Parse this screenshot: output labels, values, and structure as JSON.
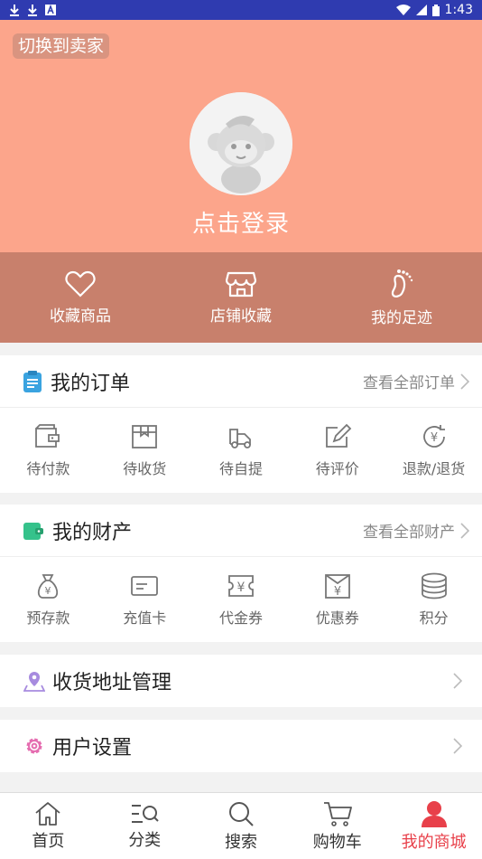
{
  "status_bar": {
    "time": "1:43",
    "icons_left": [
      "download-icon",
      "download-icon",
      "a-icon"
    ],
    "icons_right": [
      "wifi-icon",
      "signal-icon",
      "battery-icon"
    ]
  },
  "header": {
    "switch_label": "切换到卖家",
    "login_label": "点击登录",
    "bg_color": "#fca58b"
  },
  "quick": [
    {
      "label": "收藏商品",
      "icon": "heart-icon"
    },
    {
      "label": "店铺收藏",
      "icon": "shop-icon"
    },
    {
      "label": "我的足迹",
      "icon": "footprint-icon"
    }
  ],
  "orders": {
    "title": "我的订单",
    "more": "查看全部订单",
    "items": [
      {
        "label": "待付款",
        "icon": "wallet-icon"
      },
      {
        "label": "待收货",
        "icon": "box-icon"
      },
      {
        "label": "待自提",
        "icon": "truck-icon"
      },
      {
        "label": "待评价",
        "icon": "edit-icon"
      },
      {
        "label": "退款/退货",
        "icon": "refund-icon"
      }
    ]
  },
  "assets": {
    "title": "我的财产",
    "more": "查看全部财产",
    "items": [
      {
        "label": "预存款",
        "icon": "money-bag-icon"
      },
      {
        "label": "充值卡",
        "icon": "card-icon"
      },
      {
        "label": "代金券",
        "icon": "voucher-icon"
      },
      {
        "label": "优惠券",
        "icon": "coupon-icon"
      },
      {
        "label": "积分",
        "icon": "coins-icon"
      }
    ]
  },
  "address": {
    "title": "收货地址管理"
  },
  "settings": {
    "title": "用户设置"
  },
  "nav": [
    {
      "label": "首页",
      "icon": "home-icon"
    },
    {
      "label": "分类",
      "icon": "category-icon"
    },
    {
      "label": "搜索",
      "icon": "search-icon"
    },
    {
      "label": "购物车",
      "icon": "cart-icon"
    },
    {
      "label": "我的商城",
      "icon": "user-icon",
      "active": true
    }
  ],
  "colors": {
    "accent": "#e8404a",
    "status_bar": "#2f3bb0",
    "quickbar": "#c8806c"
  }
}
